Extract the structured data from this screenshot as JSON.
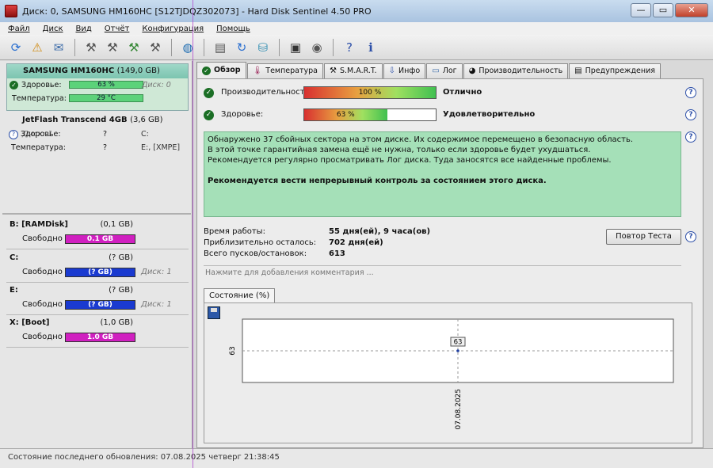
{
  "window": {
    "title": "Диск: 0, SAMSUNG HM160HC [S12TJDQZ302073]  -  Hard Disk Sentinel 4.50 PRO",
    "minimize": "—",
    "maximize": "▭",
    "close": "✕"
  },
  "menu": [
    "Файл",
    "Диск",
    "Вид",
    "Отчёт",
    "Конфигурация",
    "Помощь"
  ],
  "disks": [
    {
      "name": "SAMSUNG HM160HC",
      "size": "(149,0 GB)",
      "health_label": "Здоровье:",
      "health_value": "63 %",
      "health_percent": 63,
      "health_extra": "Диск: 0",
      "temp_label": "Температура:",
      "temp_value": "29 °C"
    },
    {
      "name": "JetFlash Transcend 4GB",
      "size": "(3,6 GB)",
      "extra": "Диск: 1",
      "health_label": "Здоровье:",
      "health_value": "?",
      "health_extra": "C:",
      "temp_label": "Температура:",
      "temp_value": "?",
      "temp_extra": "E:, [XMPE]"
    }
  ],
  "volumes": [
    {
      "name": "B: [RAMDisk]",
      "size": "(0,1 GB)",
      "free_label": "Свободно",
      "free_value": "0.1 GB",
      "color": "#d020c0",
      "disk": ""
    },
    {
      "name": "C:",
      "size": "(? GB)",
      "free_label": "Свободно",
      "free_value": "(? GB)",
      "color": "#1a3ad0",
      "disk": "Диск: 1"
    },
    {
      "name": "E:",
      "size": "(? GB)",
      "free_label": "Свободно",
      "free_value": "(? GB)",
      "color": "#1a3ad0",
      "disk": "Диск: 1"
    },
    {
      "name": "X: [Boot]",
      "size": "(1,0 GB)",
      "free_label": "Свободно",
      "free_value": "1.0 GB",
      "color": "#d020c0",
      "disk": ""
    }
  ],
  "tabs": [
    "Обзор",
    "Температура",
    "S.M.A.R.T.",
    "Инфо",
    "Лог",
    "Производительность",
    "Предупреждения"
  ],
  "overview": {
    "perf_label": "Производительность:",
    "perf_value": "100 %",
    "perf_percent": 100,
    "perf_status": "Отлично",
    "health_label": "Здоровье:",
    "health_value": "63 %",
    "health_percent": 63,
    "health_status": "Удовлетворительно",
    "message_lines": [
      "Обнаружено 37 сбойных сектора на этом диске. Их содержимое перемещено в безопасную область.",
      "В этой точке гарантийная замена ещё не нужна, только если здоровье будет ухудшаться.",
      "Рекомендуется регулярно просматривать Лог диска. Туда заносятся все найденные проблемы."
    ],
    "message_bold": "Рекомендуется вести непрерывный контроль за состоянием этого диска.",
    "stats": [
      {
        "label": "Время работы:",
        "value": "55 дня(ей), 9 часа(ов)"
      },
      {
        "label": "Приблизительно осталось:",
        "value": "702 дня(ей)"
      },
      {
        "label": "Всего пусков/остановок:",
        "value": "613"
      }
    ],
    "repeat_test": "Повтор Теста",
    "comment_placeholder": "Нажмите для добавления комментария ...",
    "subtab": "Состояние (%)"
  },
  "chart_data": {
    "type": "line",
    "x": [
      "07.08.2025"
    ],
    "y": [
      63
    ],
    "y_tick_labels": [
      "63"
    ],
    "x_tick_labels": [
      "07.08.2025"
    ],
    "point_labels": [
      "63"
    ],
    "grid": true
  },
  "status_bar": "Состояние последнего обновления: 07.08.2025 четверг 21:38:45"
}
